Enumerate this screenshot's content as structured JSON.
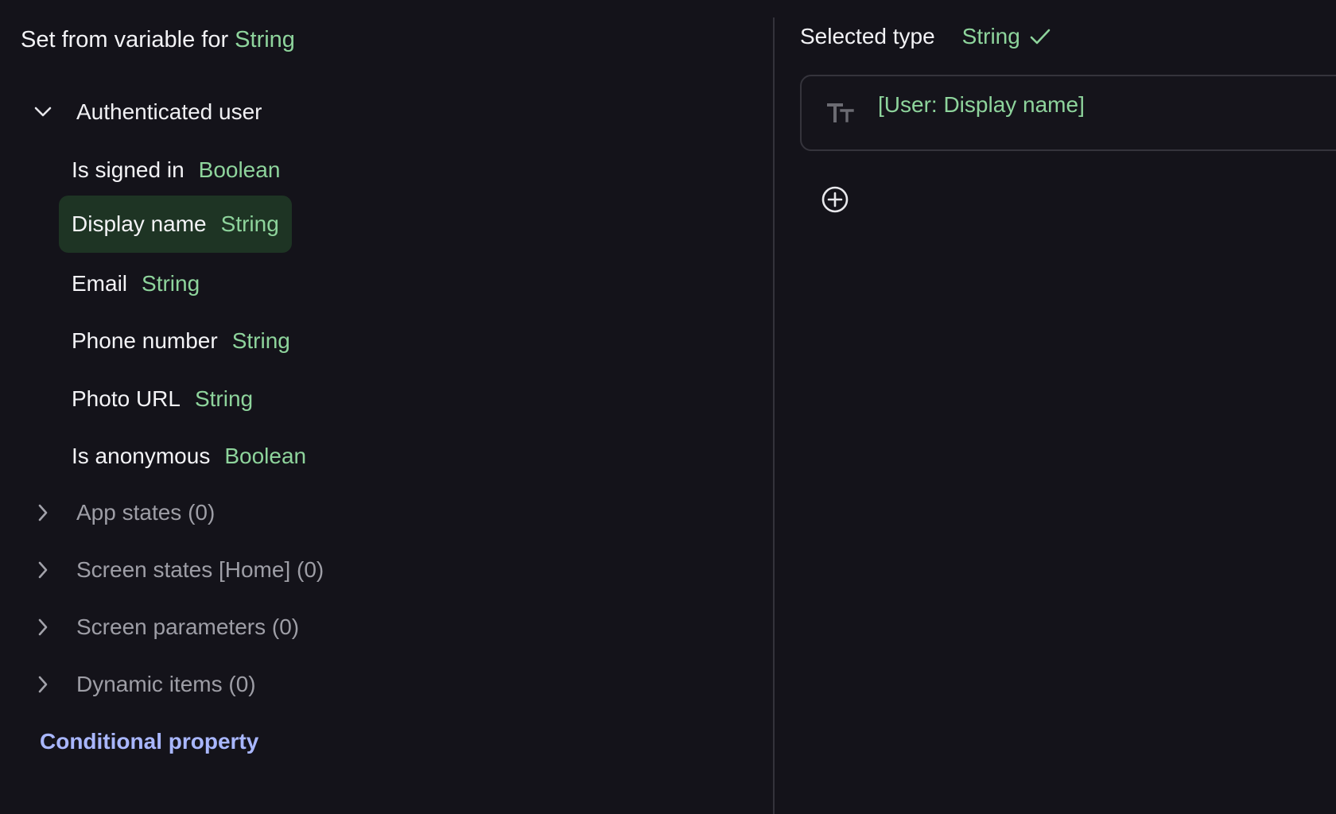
{
  "left_panel": {
    "title_prefix": "Set from variable for",
    "title_type": "String",
    "groups": {
      "authenticated_user": {
        "label": "Authenticated user",
        "items": [
          {
            "name": "Is signed in",
            "type": "Boolean"
          },
          {
            "name": "Display name",
            "type": "String"
          },
          {
            "name": "Email",
            "type": "String"
          },
          {
            "name": "Phone number",
            "type": "String"
          },
          {
            "name": "Photo URL",
            "type": "String"
          },
          {
            "name": "Is anonymous",
            "type": "Boolean"
          }
        ]
      },
      "app_states": {
        "label": "App states (0)"
      },
      "screen_states": {
        "label": "Screen states [Home] (0)"
      },
      "screen_parameters": {
        "label": "Screen parameters (0)"
      },
      "dynamic_items": {
        "label": "Dynamic items (0)"
      }
    },
    "conditional_property": "Conditional property"
  },
  "right_panel": {
    "selected_type_label": "Selected type",
    "selected_type_value": "String",
    "value_text": "[User: Display name]",
    "icons": [
      "check-icon",
      "text-type-icon",
      "add-circle-icon"
    ]
  },
  "colors": {
    "background": "#14131a",
    "type_green": "#8ed49c",
    "selected_row": "#1e3424",
    "link_blue": "#a9b7ff",
    "muted_text": "#9e9ea6"
  }
}
